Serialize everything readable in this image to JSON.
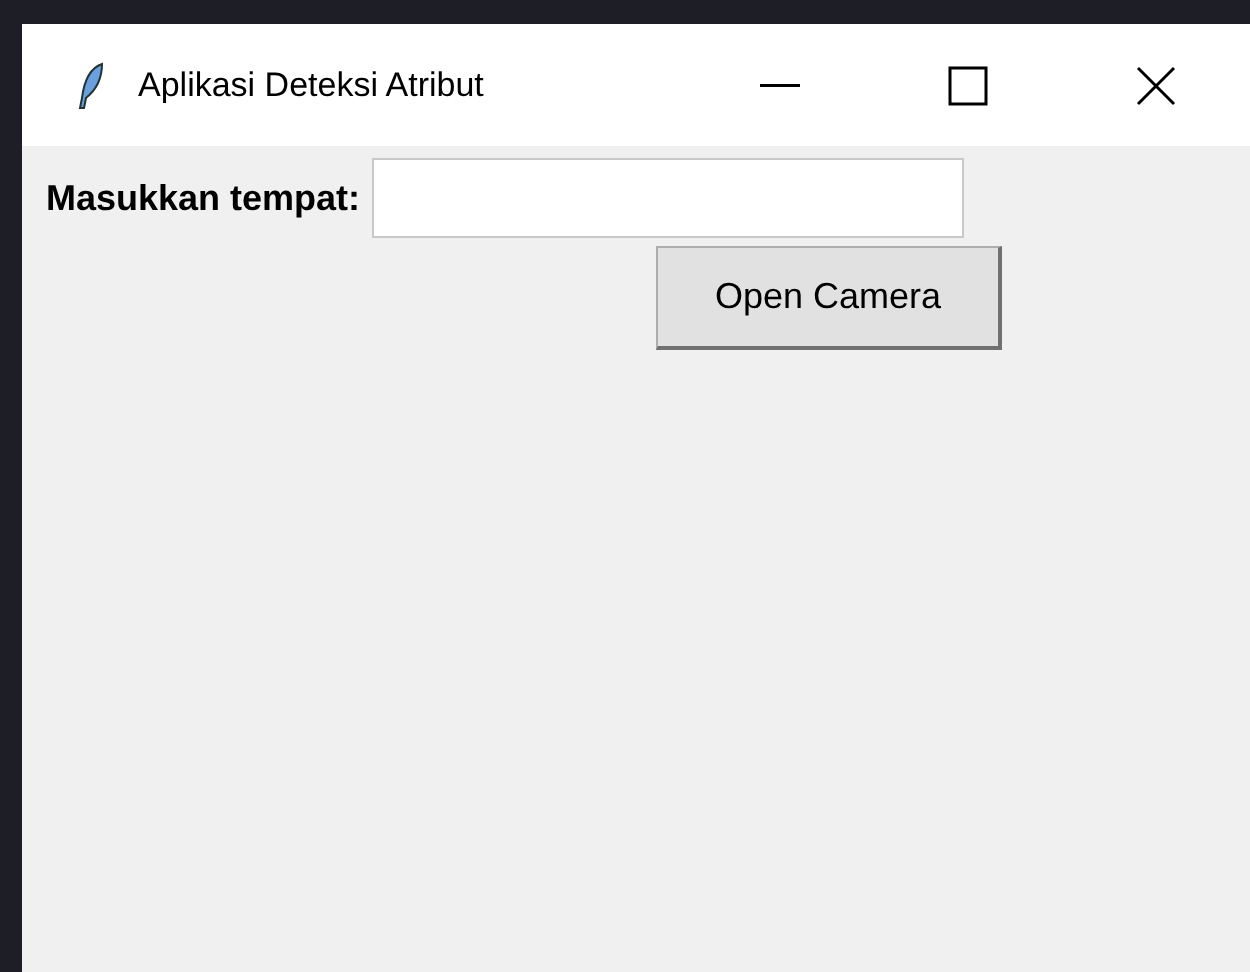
{
  "window": {
    "title": "Aplikasi Deteksi Atribut"
  },
  "form": {
    "label": "Masukkan tempat:",
    "button": "Open Camera"
  }
}
